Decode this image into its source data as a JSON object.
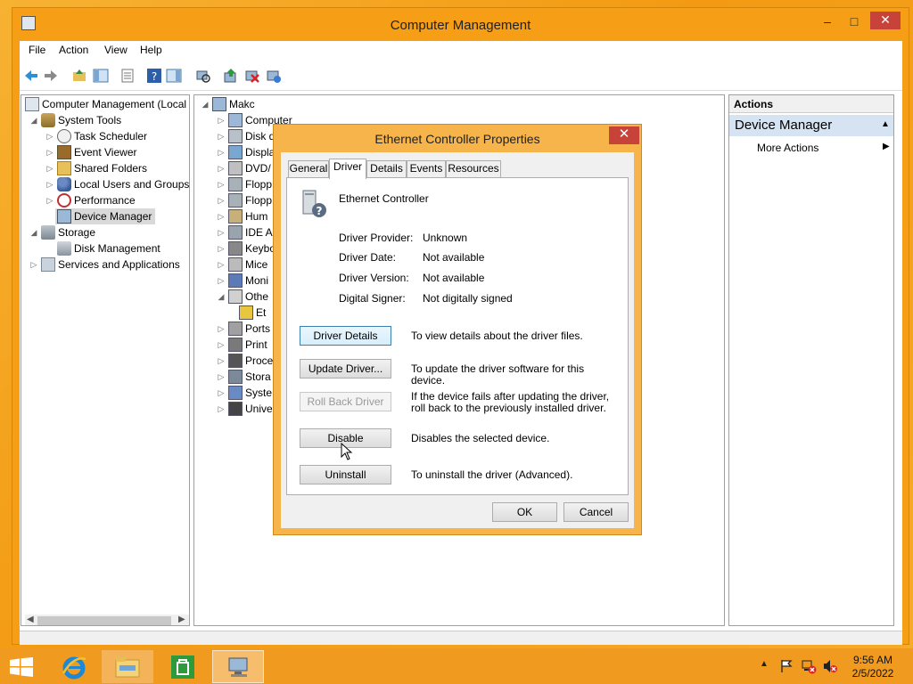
{
  "window": {
    "title": "Computer Management",
    "minimize": "–",
    "maximize": "□",
    "close": "✕"
  },
  "menu": [
    "File",
    "Action",
    "View",
    "Help"
  ],
  "tree": {
    "root": "Computer Management (Local",
    "system_tools": "System Tools",
    "items": [
      "Task Scheduler",
      "Event Viewer",
      "Shared Folders",
      "Local Users and Groups",
      "Performance",
      "Device Manager"
    ],
    "storage": "Storage",
    "disk_mgmt": "Disk Management",
    "services": "Services and Applications"
  },
  "devices": {
    "root": "Makc",
    "items": [
      "Computer",
      "Disk d",
      "Displa",
      "DVD/",
      "Flopp",
      "Flopp",
      "Hum",
      "IDE A",
      "Keybo",
      "Mice",
      "Moni",
      "Othe",
      "Et",
      "Ports",
      "Print",
      "Proce",
      "Stora",
      "Syste",
      "Unive"
    ]
  },
  "actions": {
    "header": "Actions",
    "section": "Device Manager",
    "more": "More Actions"
  },
  "dialog": {
    "title": "Ethernet Controller Properties",
    "close": "✕",
    "tabs": [
      "General",
      "Driver",
      "Details",
      "Events",
      "Resources"
    ],
    "device_name": "Ethernet Controller",
    "fields": [
      {
        "label": "Driver Provider:",
        "value": "Unknown"
      },
      {
        "label": "Driver Date:",
        "value": "Not available"
      },
      {
        "label": "Driver Version:",
        "value": "Not available"
      },
      {
        "label": "Digital Signer:",
        "value": "Not digitally signed"
      }
    ],
    "buttons": {
      "details": "Driver Details",
      "details_desc": "To view details about the driver files.",
      "update": "Update Driver...",
      "update_desc": "To update the driver software for this device.",
      "rollback": "Roll Back Driver",
      "rollback_desc": "If the device fails after updating the driver, roll back to the previously installed driver.",
      "disable": "Disable",
      "disable_desc": "Disables the selected device.",
      "uninstall": "Uninstall",
      "uninstall_desc": "To uninstall the driver (Advanced)."
    },
    "ok": "OK",
    "cancel": "Cancel"
  },
  "taskbar": {
    "time": "9:56 AM",
    "date": "2/5/2022"
  },
  "colors": {
    "accent": "#f59e16",
    "selection": "#d9d9d9",
    "actions_header": "#d5e3f2"
  }
}
